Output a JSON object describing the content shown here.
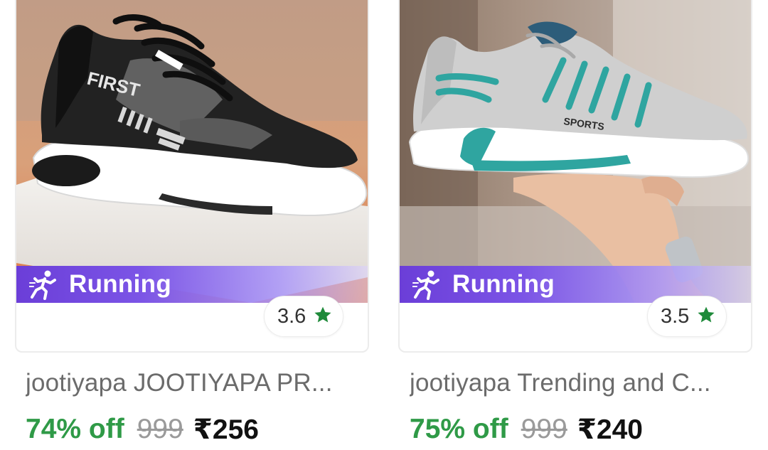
{
  "products": [
    {
      "tag_label": "Running",
      "rating": "3.6",
      "title": "jootiyapa JOOTIYAPA PR...",
      "discount": "74% off",
      "mrp": "999",
      "price": "₹256",
      "shoe_text": "FIRST"
    },
    {
      "tag_label": "Running",
      "rating": "3.5",
      "title": "jootiyapa Trending and C...",
      "discount": "75% off",
      "mrp": "999",
      "price": "₹240",
      "shoe_text": "SPORTS"
    }
  ],
  "colors": {
    "tag_purple": "#6b3ed8",
    "discount_green": "#2f9a47",
    "star_green": "#1e8a3a"
  },
  "icons": [
    "running-person-icon",
    "star-icon"
  ]
}
